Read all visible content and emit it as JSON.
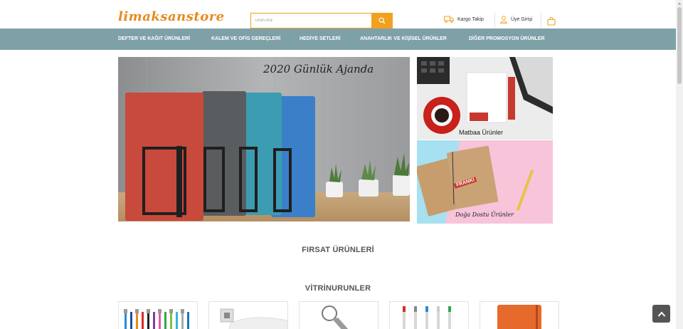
{
  "header": {
    "logo": "limaksanstore",
    "search_placeholder": "Ürün Ara",
    "cargo_label": "Kargo Takip",
    "member_label": "Üye Girişi"
  },
  "nav": {
    "items": [
      {
        "label": "DEFTER VE KAĞIT ÜRÜNLERİ"
      },
      {
        "label": "KALEM VE OFİS GEREÇLERİ"
      },
      {
        "label": "HEDİYE SETLERİ"
      },
      {
        "label": "ANAHTARLIK VE KİŞİSEL ÜRÜNLER"
      },
      {
        "label": "DİĞER PROMOSYON ÜRÜNLER"
      }
    ]
  },
  "banners": {
    "main_caption": "2020 Günlük Ajanda",
    "side1_caption": "Matbaa Ürünler",
    "side2_caption": "Doğa Dostu Ürünler",
    "side2_stamp": "FRANKI"
  },
  "sections": {
    "firsat_title": "FIRSAT ÜRÜNLERİ",
    "vitrin_title": "VİTRİNURUNLER"
  },
  "colors": {
    "accent": "#f2a01f",
    "nav_bg": "#7ea1a8",
    "logo": "#e68a1e"
  },
  "icons": [
    "search-icon",
    "truck-icon",
    "user-icon",
    "shopping-bag-icon",
    "chevron-up-icon"
  ]
}
